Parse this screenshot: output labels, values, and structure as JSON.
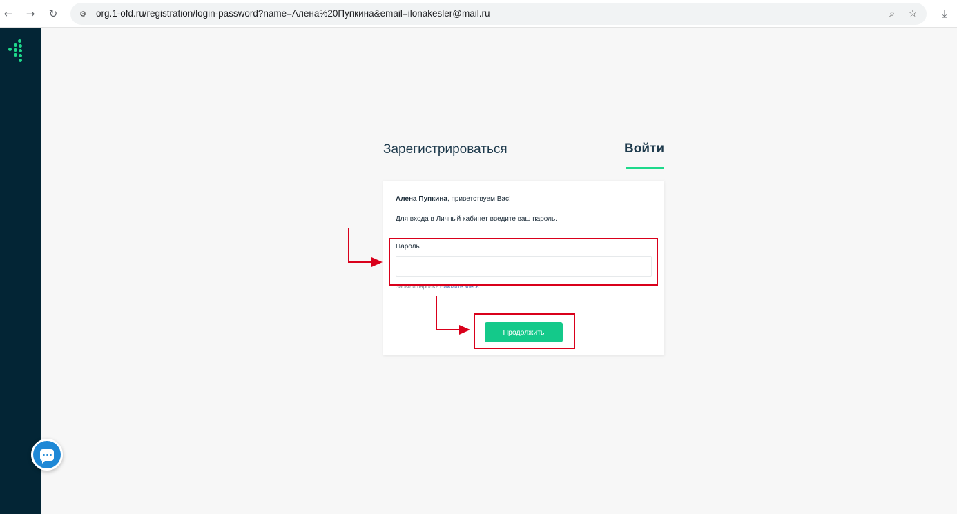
{
  "browser": {
    "url": "org.1-ofd.ru/registration/login-password?name=Алена%20Пупкина&email=ilonakesler@mail.ru"
  },
  "tabs": {
    "register_label": "Зарегистрироваться",
    "login_label": "Войти"
  },
  "form": {
    "user_name": "Алена Пупкина",
    "greeting_suffix": ", приветствуем Вас!",
    "instruction": "Для входа в Личный кабинет введите ваш пароль.",
    "password_label": "Пароль",
    "password_value": "",
    "forgot_prefix": "Забыли пароль? ",
    "forgot_link": "Нажмите здесь",
    "continue_label": "Продолжить"
  },
  "colors": {
    "sidebar": "#032535",
    "accent": "#1ed98b",
    "button": "#14c98a",
    "annotation": "#d9001b",
    "chat": "#1e88d6"
  },
  "icons": [
    "back-arrow-icon",
    "forward-arrow-icon",
    "reload-icon",
    "site-settings-icon",
    "zoom-icon",
    "star-icon",
    "download-icon",
    "logo-icon",
    "chat-icon"
  ]
}
